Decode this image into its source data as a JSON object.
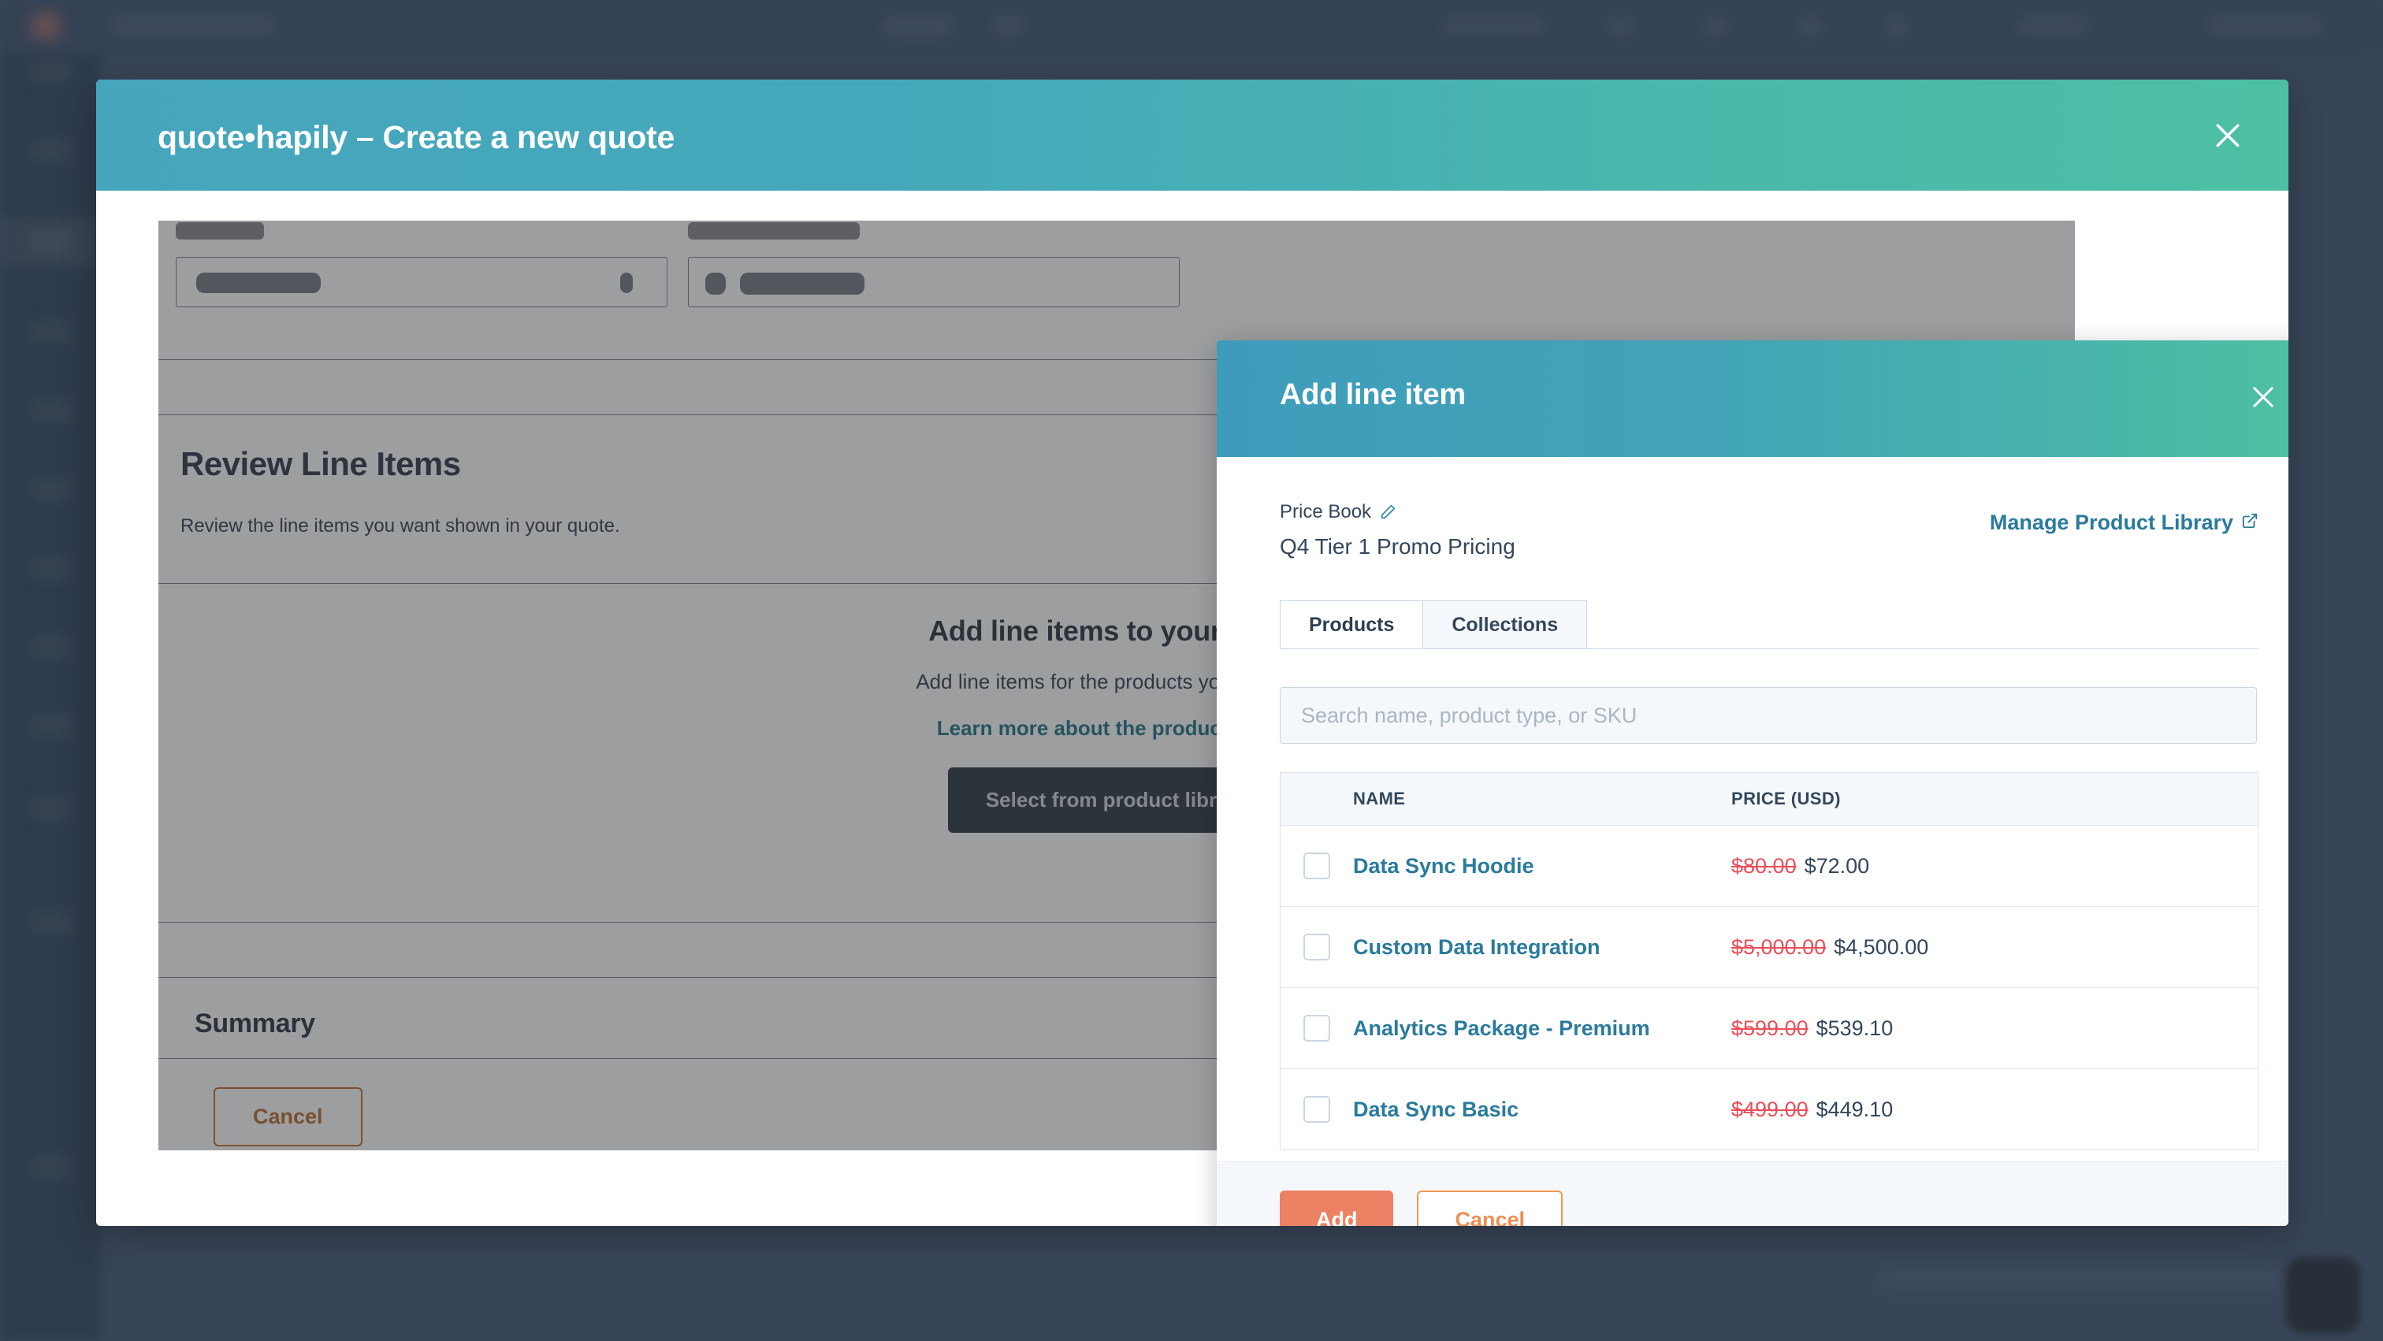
{
  "modal": {
    "title": "quote•hapily – Create a new quote",
    "close_icon": "close-icon"
  },
  "wizard": {
    "heading": "Review Line Items",
    "description": "Review the line items you want shown in your quote.",
    "empty_state": {
      "heading": "Add line items to your quote",
      "subtext": "Add line items for the products you're selling",
      "link": "Learn more about the product library",
      "button": "Select from product library"
    },
    "summary_heading": "Summary",
    "cancel_label": "Cancel"
  },
  "drawer": {
    "title": "Add line item",
    "close_icon": "close-icon",
    "price_book": {
      "label": "Price Book",
      "edit_icon": "pencil-icon",
      "value": "Q4 Tier 1 Promo Pricing"
    },
    "manage_library": {
      "label": "Manage Product Library",
      "icon": "external-link-icon"
    },
    "tabs": [
      {
        "label": "Products",
        "active": true
      },
      {
        "label": "Collections",
        "active": false
      }
    ],
    "search": {
      "placeholder": "Search name, product type, or SKU",
      "value": ""
    },
    "table": {
      "columns": [
        "NAME",
        "PRICE (USD)"
      ],
      "rows": [
        {
          "name": "Data Sync Hoodie",
          "old_price": "$80.00",
          "price": "$72.00",
          "checked": false
        },
        {
          "name": "Custom Data Integration",
          "old_price": "$5,000.00",
          "price": "$4,500.00",
          "checked": false
        },
        {
          "name": "Analytics Package - Premium",
          "old_price": "$599.00",
          "price": "$539.10",
          "checked": false
        },
        {
          "name": "Data Sync Basic",
          "old_price": "$499.00",
          "price": "$449.10",
          "checked": false
        }
      ]
    },
    "footer": {
      "add_label": "Add",
      "cancel_label": "Cancel"
    }
  },
  "colors": {
    "header_gradient_start": "#45a5bd",
    "header_gradient_end": "#4dc0a3",
    "link_teal": "#2a7b9b",
    "accent_orange": "#ec8164",
    "strike_red": "#e8505b",
    "app_navy": "#2f3e50"
  }
}
